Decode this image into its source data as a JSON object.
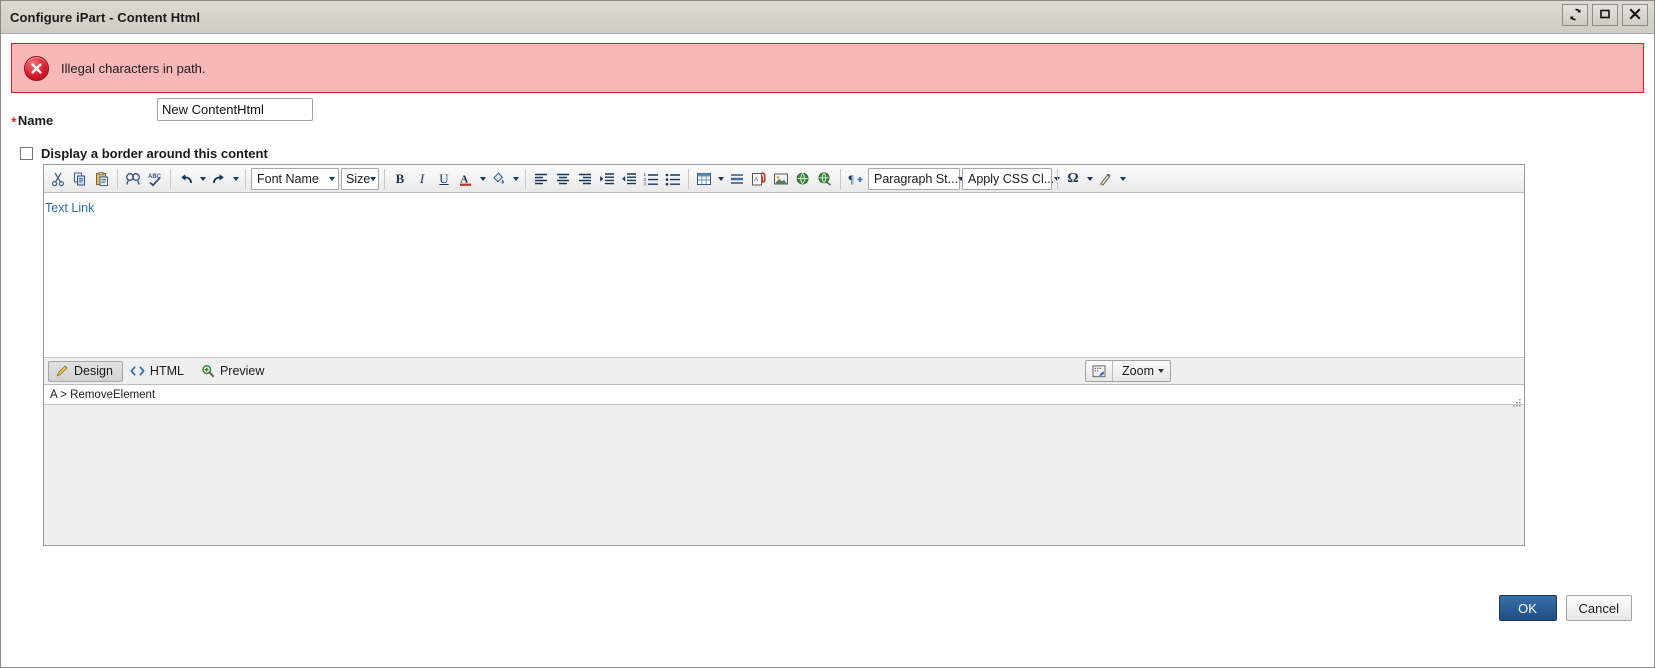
{
  "window": {
    "title": "Configure iPart - Content Html",
    "buttons": [
      {
        "name": "refresh",
        "glyph": "↻"
      },
      {
        "name": "maximize",
        "glyph": "■"
      },
      {
        "name": "close",
        "glyph": "✕"
      }
    ]
  },
  "error": {
    "icon": "error-circle-x-icon",
    "message": "Illegal characters in path."
  },
  "form": {
    "name_label": "Name",
    "required_marker": "*",
    "name_value": "New ContentHtml",
    "name_placeholder": "",
    "border_checkbox_label": "Display a border around this content",
    "border_checkbox_checked": false
  },
  "editor": {
    "toolbar": {
      "clipboard": [
        {
          "name": "cut-icon",
          "label": "Cut"
        },
        {
          "name": "copy-icon",
          "label": "Copy"
        },
        {
          "name": "paste-icon",
          "label": "Paste"
        }
      ],
      "tools": [
        {
          "name": "find-icon",
          "label": "Find"
        },
        {
          "name": "spellcheck-icon",
          "label": "Spell Check"
        }
      ],
      "history": [
        {
          "name": "undo-icon",
          "label": "Undo"
        },
        {
          "name": "redo-icon",
          "label": "Redo"
        }
      ],
      "font_name_label": "Font Name",
      "font_size_label": "Size",
      "format": [
        {
          "name": "bold-icon",
          "label": "B"
        },
        {
          "name": "italic-icon",
          "label": "I"
        },
        {
          "name": "underline-icon",
          "label": "U"
        }
      ],
      "color": [
        {
          "name": "font-color-icon",
          "label": "A"
        },
        {
          "name": "highlight-color-icon",
          "label": "Highlight"
        }
      ],
      "align": [
        {
          "name": "align-left-icon",
          "label": "Align Left"
        },
        {
          "name": "align-center-icon",
          "label": "Align Center"
        },
        {
          "name": "align-right-icon",
          "label": "Align Right"
        }
      ],
      "indent": [
        {
          "name": "indent-icon",
          "label": "Increase Indent"
        },
        {
          "name": "outdent-icon",
          "label": "Decrease Indent"
        }
      ],
      "lists": [
        {
          "name": "numbered-list-icon",
          "label": "Numbered List"
        },
        {
          "name": "bullet-list-icon",
          "label": "Bulleted List"
        }
      ],
      "insert": [
        {
          "name": "insert-table-icon",
          "label": "Insert Table"
        },
        {
          "name": "horizontal-rule-icon",
          "label": "Horizontal Rule"
        },
        {
          "name": "insert-document-icon",
          "label": "Insert Document"
        },
        {
          "name": "insert-image-icon",
          "label": "Insert Image"
        },
        {
          "name": "insert-hyperlink-icon",
          "label": "Insert Hyperlink"
        },
        {
          "name": "remove-hyperlink-icon",
          "label": "Remove Hyperlink"
        }
      ],
      "paragraph_mark_icon": "paragraph-mark-add-icon",
      "paragraph_style_label": "Paragraph St...",
      "apply_css_label": "Apply CSS Cl...",
      "symbol_label": "Ω",
      "format_painter_icon": "format-painter-icon"
    },
    "content": {
      "link_text": "Text Link"
    },
    "tabs": [
      {
        "name": "tab-design",
        "label": "Design",
        "icon": "pencil-icon",
        "active": true
      },
      {
        "name": "tab-html",
        "label": "HTML",
        "icon": "code-brackets-icon",
        "active": false
      },
      {
        "name": "tab-preview",
        "label": "Preview",
        "icon": "magnifier-plus-icon",
        "active": false
      }
    ],
    "zoom": {
      "icon": "zoom-select-icon",
      "label": "Zoom"
    },
    "status_path": "A > RemoveElement"
  },
  "footer": {
    "ok_label": "OK",
    "cancel_label": "Cancel"
  },
  "colors": {
    "error_bg": "#f8b8b8",
    "error_border": "#d02020",
    "accent": "#1d4e85",
    "link": "#2a6bb5",
    "icon_blue": "#16365c"
  }
}
